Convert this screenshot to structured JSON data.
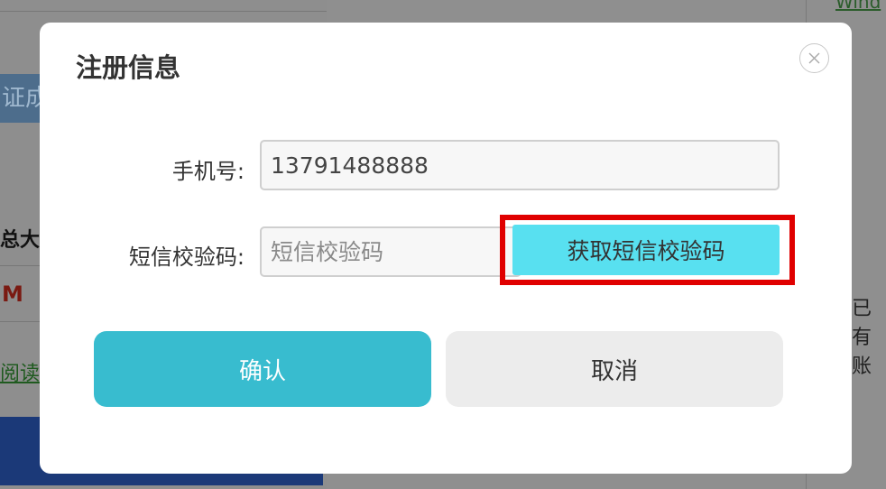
{
  "background": {
    "banner_text": "证成",
    "label_text": "总大小",
    "size_text": "M",
    "read_link": "阅读",
    "right_link": "Wind",
    "right_text": "已有账"
  },
  "modal": {
    "title": "注册信息",
    "close_icon": "close-icon",
    "phone": {
      "label": "手机号:",
      "value": "13791488888"
    },
    "sms_code": {
      "label": "短信校验码:",
      "placeholder": "短信校验码",
      "value": ""
    },
    "get_code_button": "获取短信校验码",
    "confirm_button": "确认",
    "cancel_button": "取消"
  },
  "colors": {
    "confirm": "#38bccf",
    "get_code": "#58e0f0",
    "highlight_border": "#e00000",
    "cancel": "#ececec"
  }
}
